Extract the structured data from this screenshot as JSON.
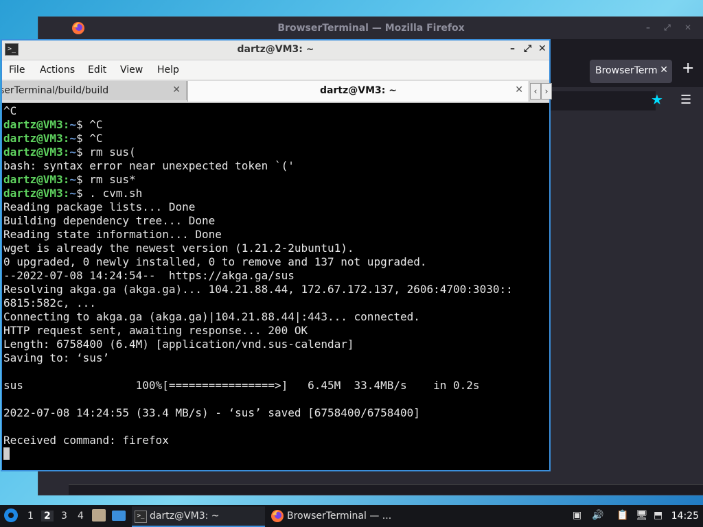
{
  "firefox": {
    "title": "BrowserTerminal — Mozilla Firefox",
    "tab_label": "BrowserTerminal",
    "tab_close": "✕",
    "newtab_label": "+",
    "star_icon": "★",
    "menu_icon": "☰"
  },
  "terminal": {
    "title": "dartz@VM3: ~",
    "window_buttons": [
      "–",
      "⤢",
      "✕"
    ],
    "menu": [
      "File",
      "Actions",
      "Edit",
      "View",
      "Help"
    ],
    "tabs": [
      {
        "label": "serTerminal/build/build",
        "close": "✕"
      },
      {
        "label": "dartz@VM3: ~",
        "close": "✕"
      }
    ],
    "scroll_left": "‹",
    "scroll_right": "›",
    "prompt_user": "dartz@VM3",
    "prompt_sep": ":",
    "prompt_path": "~",
    "prompt_end": "$ ",
    "lines": [
      {
        "type": "output",
        "text": "^C"
      },
      {
        "type": "prompt",
        "text": "^C"
      },
      {
        "type": "prompt",
        "text": "^C"
      },
      {
        "type": "prompt",
        "text": "rm sus("
      },
      {
        "type": "output",
        "text": "bash: syntax error near unexpected token `('"
      },
      {
        "type": "prompt",
        "text": "rm sus*"
      },
      {
        "type": "prompt",
        "text": ". cvm.sh"
      },
      {
        "type": "output",
        "text": "Reading package lists... Done"
      },
      {
        "type": "output",
        "text": "Building dependency tree... Done"
      },
      {
        "type": "output",
        "text": "Reading state information... Done"
      },
      {
        "type": "output",
        "text": "wget is already the newest version (1.21.2-2ubuntu1)."
      },
      {
        "type": "output",
        "text": "0 upgraded, 0 newly installed, 0 to remove and 137 not upgraded."
      },
      {
        "type": "output",
        "text": "--2022-07-08 14:24:54--  https://akga.ga/sus"
      },
      {
        "type": "output",
        "text": "Resolving akga.ga (akga.ga)... 104.21.88.44, 172.67.172.137, 2606:4700:3030::"
      },
      {
        "type": "output",
        "text": "6815:582c, ..."
      },
      {
        "type": "output",
        "text": "Connecting to akga.ga (akga.ga)|104.21.88.44|:443... connected."
      },
      {
        "type": "output",
        "text": "HTTP request sent, awaiting response... 200 OK"
      },
      {
        "type": "output",
        "text": "Length: 6758400 (6.4M) [application/vnd.sus-calendar]"
      },
      {
        "type": "output",
        "text": "Saving to: ‘sus’"
      },
      {
        "type": "output",
        "text": ""
      },
      {
        "type": "output",
        "text": "sus                 100%[================>]   6.45M  33.4MB/s    in 0.2s"
      },
      {
        "type": "output",
        "text": ""
      },
      {
        "type": "output",
        "text": "2022-07-08 14:24:55 (33.4 MB/s) - ‘sus’ saved [6758400/6758400]"
      },
      {
        "type": "output",
        "text": ""
      },
      {
        "type": "output",
        "text": "Received command: firefox"
      },
      {
        "type": "cursor",
        "text": ""
      }
    ]
  },
  "taskbar": {
    "workspaces": [
      "1",
      "2",
      "3",
      "4"
    ],
    "active_workspace": "2",
    "tasks": [
      {
        "label": "dartz@VM3: ~",
        "icon": "terminal-icon"
      },
      {
        "label": "BrowserTerminal — ...",
        "icon": "firefox-icon"
      }
    ],
    "tray": {
      "volume_icon": "🔊",
      "clipboard_icon": "📋",
      "monitor_icon": "🖥"
    },
    "clock": "14:25"
  },
  "colors": {
    "accent": "#3b8fdc",
    "prompt_green": "#5fd35f",
    "prompt_blue": "#6a9bd8",
    "terminal_bg": "#000000",
    "firefox_dark": "#1c1b22",
    "firefox_star": "#00ddff"
  }
}
